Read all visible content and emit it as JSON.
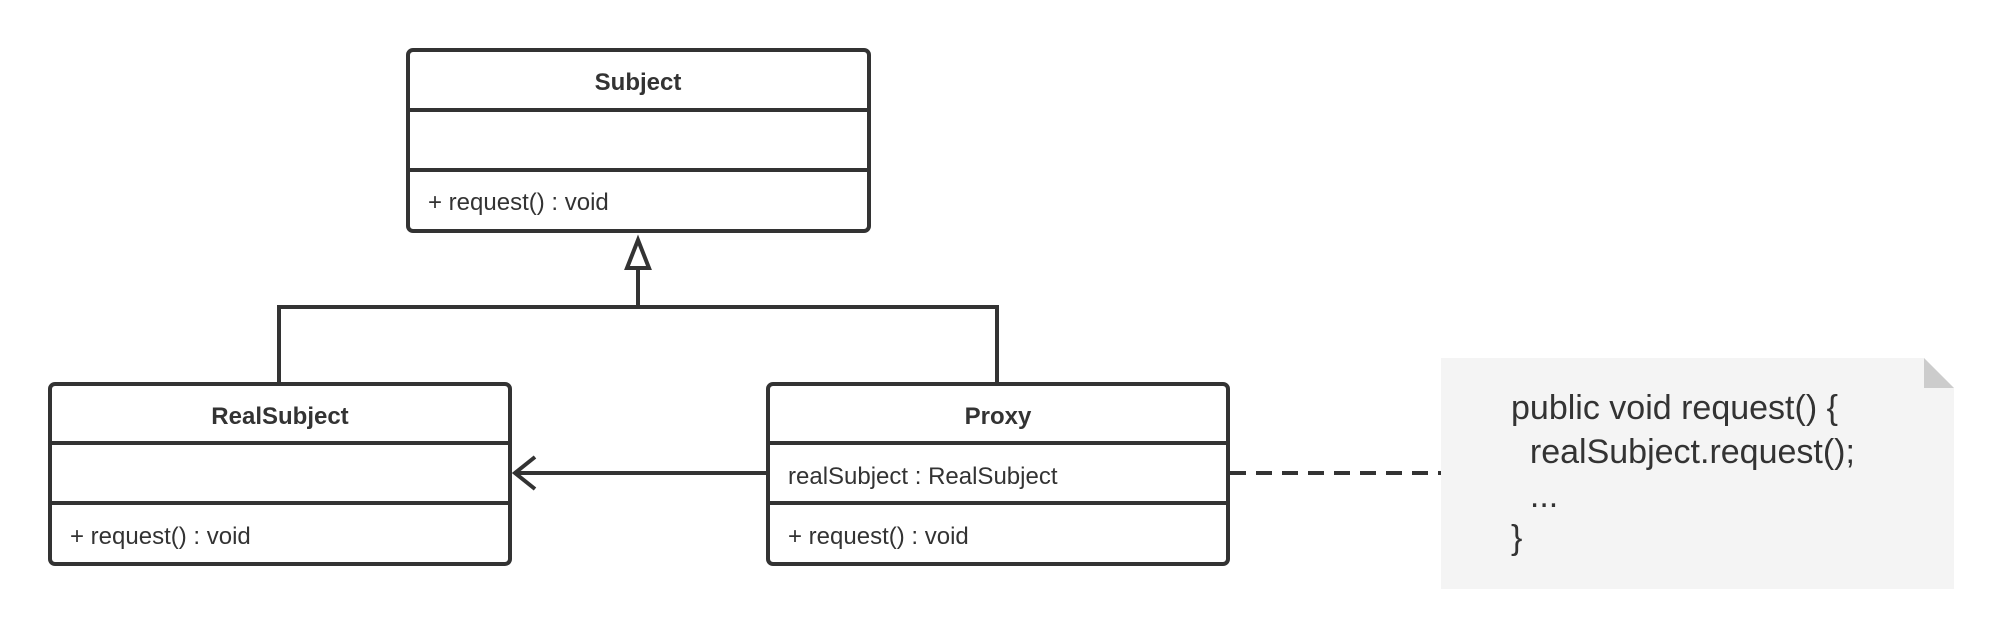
{
  "classes": {
    "subject": {
      "name": "Subject",
      "attributes": "",
      "operations": "+ request() : void"
    },
    "real_subject": {
      "name": "RealSubject",
      "attributes": "",
      "operations": "+ request() : void"
    },
    "proxy": {
      "name": "Proxy",
      "attributes": "realSubject : RealSubject",
      "operations": "+ request() : void"
    }
  },
  "relations": [
    {
      "type": "generalization",
      "from": "RealSubject",
      "to": "Subject"
    },
    {
      "type": "generalization",
      "from": "Proxy",
      "to": "Subject"
    },
    {
      "type": "association",
      "from": "Proxy",
      "to": "RealSubject"
    },
    {
      "type": "note-link",
      "from": "Proxy",
      "to": "note"
    }
  ],
  "note": {
    "lines": [
      "public void request() {",
      "  realSubject.request();",
      "  ...",
      "}"
    ],
    "fill": "#f4f4f4",
    "corner": "#cccccc"
  },
  "colors": {
    "stroke": "#333333"
  }
}
